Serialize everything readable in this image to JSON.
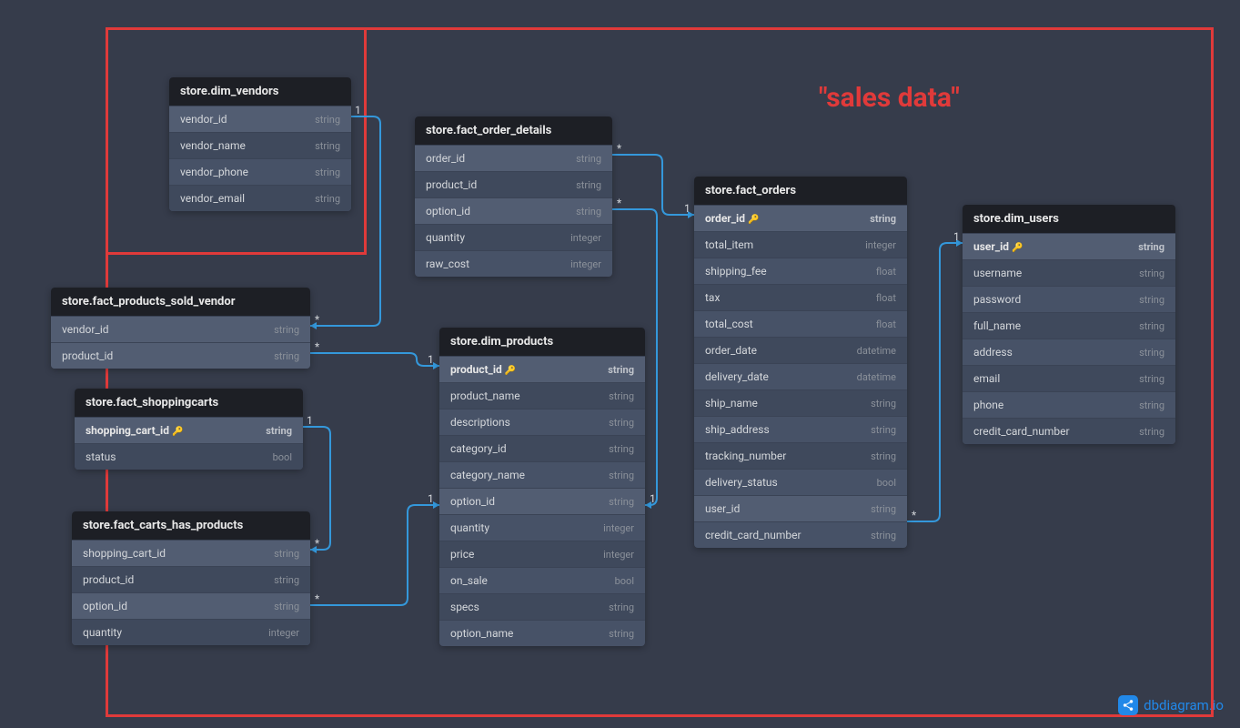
{
  "annotation": "\"sales data\"",
  "logo_text": "dbdiagram.io",
  "tables": {
    "dim_vendors": {
      "title": "store.dim_vendors",
      "cols": [
        {
          "name": "vendor_id",
          "type": "string",
          "hl": true
        },
        {
          "name": "vendor_name",
          "type": "string"
        },
        {
          "name": "vendor_phone",
          "type": "string"
        },
        {
          "name": "vendor_email",
          "type": "string"
        }
      ]
    },
    "fact_order_details": {
      "title": "store.fact_order_details",
      "cols": [
        {
          "name": "order_id",
          "type": "string",
          "hl": true
        },
        {
          "name": "product_id",
          "type": "string"
        },
        {
          "name": "option_id",
          "type": "string",
          "hl": true
        },
        {
          "name": "quantity",
          "type": "integer"
        },
        {
          "name": "raw_cost",
          "type": "integer"
        }
      ]
    },
    "fact_orders": {
      "title": "store.fact_orders",
      "cols": [
        {
          "name": "order_id",
          "type": "string",
          "bold": true,
          "key": true,
          "hl": true
        },
        {
          "name": "total_item",
          "type": "integer"
        },
        {
          "name": "shipping_fee",
          "type": "float"
        },
        {
          "name": "tax",
          "type": "float"
        },
        {
          "name": "total_cost",
          "type": "float"
        },
        {
          "name": "order_date",
          "type": "datetime"
        },
        {
          "name": "delivery_date",
          "type": "datetime"
        },
        {
          "name": "ship_name",
          "type": "string"
        },
        {
          "name": "ship_address",
          "type": "string"
        },
        {
          "name": "tracking_number",
          "type": "string"
        },
        {
          "name": "delivery_status",
          "type": "bool"
        },
        {
          "name": "user_id",
          "type": "string",
          "hl": true
        },
        {
          "name": "credit_card_number",
          "type": "string"
        }
      ]
    },
    "dim_users": {
      "title": "store.dim_users",
      "cols": [
        {
          "name": "user_id",
          "type": "string",
          "bold": true,
          "key": true,
          "hl": true
        },
        {
          "name": "username",
          "type": "string"
        },
        {
          "name": "password",
          "type": "string"
        },
        {
          "name": "full_name",
          "type": "string"
        },
        {
          "name": "address",
          "type": "string"
        },
        {
          "name": "email",
          "type": "string"
        },
        {
          "name": "phone",
          "type": "string"
        },
        {
          "name": "credit_card_number",
          "type": "string"
        }
      ]
    },
    "fact_products_sold_vendor": {
      "title": "store.fact_products_sold_vendor",
      "cols": [
        {
          "name": "vendor_id",
          "type": "string",
          "hl": true
        },
        {
          "name": "product_id",
          "type": "string",
          "hl": true
        }
      ]
    },
    "dim_products": {
      "title": "store.dim_products",
      "cols": [
        {
          "name": "product_id",
          "type": "string",
          "bold": true,
          "key": true,
          "hl": true
        },
        {
          "name": "product_name",
          "type": "string"
        },
        {
          "name": "descriptions",
          "type": "string"
        },
        {
          "name": "category_id",
          "type": "string"
        },
        {
          "name": "category_name",
          "type": "string"
        },
        {
          "name": "option_id",
          "type": "string",
          "hl": true
        },
        {
          "name": "quantity",
          "type": "integer"
        },
        {
          "name": "price",
          "type": "integer"
        },
        {
          "name": "on_sale",
          "type": "bool"
        },
        {
          "name": "specs",
          "type": "string"
        },
        {
          "name": "option_name",
          "type": "string"
        }
      ]
    },
    "fact_shoppingcarts": {
      "title": "store.fact_shoppingcarts",
      "cols": [
        {
          "name": "shopping_cart_id",
          "type": "string",
          "bold": true,
          "key": true,
          "hl": true
        },
        {
          "name": "status",
          "type": "bool"
        }
      ]
    },
    "fact_carts_has_products": {
      "title": "store.fact_carts_has_products",
      "cols": [
        {
          "name": "shopping_cart_id",
          "type": "string",
          "hl": true
        },
        {
          "name": "product_id",
          "type": "string"
        },
        {
          "name": "option_id",
          "type": "string",
          "hl": true
        },
        {
          "name": "quantity",
          "type": "integer"
        }
      ]
    }
  },
  "cardinalities": {
    "c1": "1",
    "c2": "*",
    "c3": "*",
    "c4": "1",
    "c5": "*",
    "c6": "*",
    "c7": "1",
    "c8": "*",
    "c9": "1",
    "c10": "1",
    "c11": "*",
    "c12": "1"
  }
}
